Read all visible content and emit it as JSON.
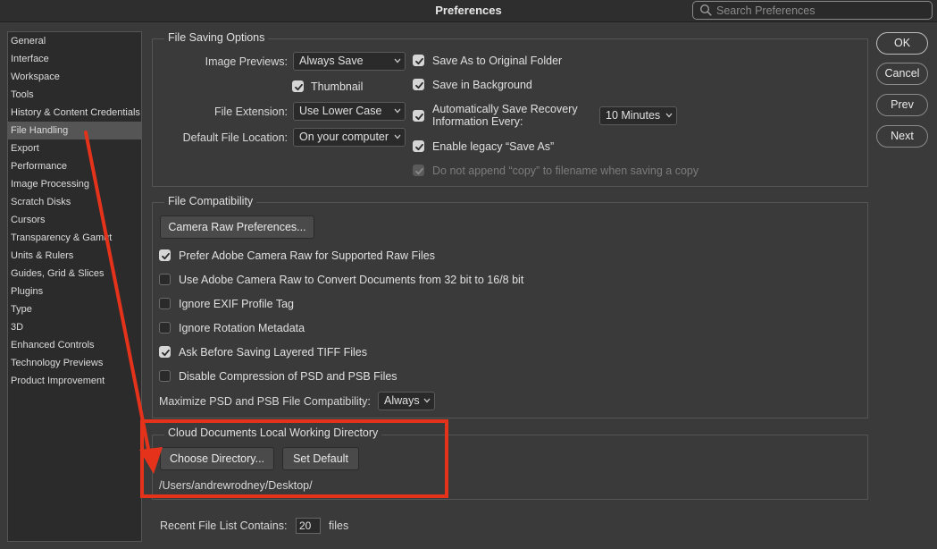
{
  "window": {
    "title": "Preferences"
  },
  "search": {
    "placeholder": "Search Preferences"
  },
  "sidebar": {
    "items": [
      {
        "label": "General"
      },
      {
        "label": "Interface"
      },
      {
        "label": "Workspace"
      },
      {
        "label": "Tools"
      },
      {
        "label": "History & Content Credentials"
      },
      {
        "label": "File Handling",
        "selected": true
      },
      {
        "label": "Export"
      },
      {
        "label": "Performance"
      },
      {
        "label": "Image Processing"
      },
      {
        "label": "Scratch Disks"
      },
      {
        "label": "Cursors"
      },
      {
        "label": "Transparency & Gamut"
      },
      {
        "label": "Units & Rulers"
      },
      {
        "label": "Guides, Grid & Slices"
      },
      {
        "label": "Plugins"
      },
      {
        "label": "Type"
      },
      {
        "label": "3D"
      },
      {
        "label": "Enhanced Controls"
      },
      {
        "label": "Technology Previews"
      },
      {
        "label": "Product Improvement"
      }
    ]
  },
  "file_saving": {
    "title": "File Saving Options",
    "image_previews_label": "Image Previews:",
    "image_previews_value": "Always Save",
    "thumbnail_label": "Thumbnail",
    "thumbnail_checked": true,
    "file_extension_label": "File Extension:",
    "file_extension_value": "Use Lower Case",
    "default_location_label": "Default File Location:",
    "default_location_value": "On your computer",
    "save_as_original_label": "Save As to Original Folder",
    "save_as_original_checked": true,
    "save_background_label": "Save in Background",
    "save_background_checked": true,
    "auto_recovery_label_1": "Automatically Save Recovery",
    "auto_recovery_label_2": "Information Every:",
    "auto_recovery_checked": true,
    "auto_recovery_value": "10 Minutes",
    "legacy_save_as_label": "Enable legacy “Save As”",
    "legacy_save_as_checked": true,
    "no_copy_label": "Do not append “copy” to filename when saving a copy",
    "no_copy_checked": true,
    "no_copy_disabled": true
  },
  "file_compat": {
    "title": "File Compatibility",
    "camera_raw_button": "Camera Raw Preferences...",
    "options": [
      {
        "label": "Prefer Adobe Camera Raw for Supported Raw Files",
        "checked": true
      },
      {
        "label": "Use Adobe Camera Raw to Convert Documents from 32 bit to 16/8 bit",
        "checked": false
      },
      {
        "label": "Ignore EXIF Profile Tag",
        "checked": false
      },
      {
        "label": "Ignore Rotation Metadata",
        "checked": false
      },
      {
        "label": "Ask Before Saving Layered TIFF Files",
        "checked": true
      },
      {
        "label": "Disable Compression of PSD and PSB Files",
        "checked": false
      }
    ],
    "maximize_label": "Maximize PSD and PSB File Compatibility:",
    "maximize_value": "Always"
  },
  "cloud": {
    "title": "Cloud Documents Local Working Directory",
    "choose_button": "Choose Directory...",
    "set_default_button": "Set Default",
    "path": "/Users/andrewrodney/Desktop/"
  },
  "recent": {
    "label": "Recent File List Contains:",
    "value": "20",
    "suffix": "files"
  },
  "buttons": {
    "ok": "OK",
    "cancel": "Cancel",
    "prev": "Prev",
    "next": "Next"
  },
  "colors": {
    "background": "#3a3a3a",
    "annotation": "#e4321b"
  }
}
